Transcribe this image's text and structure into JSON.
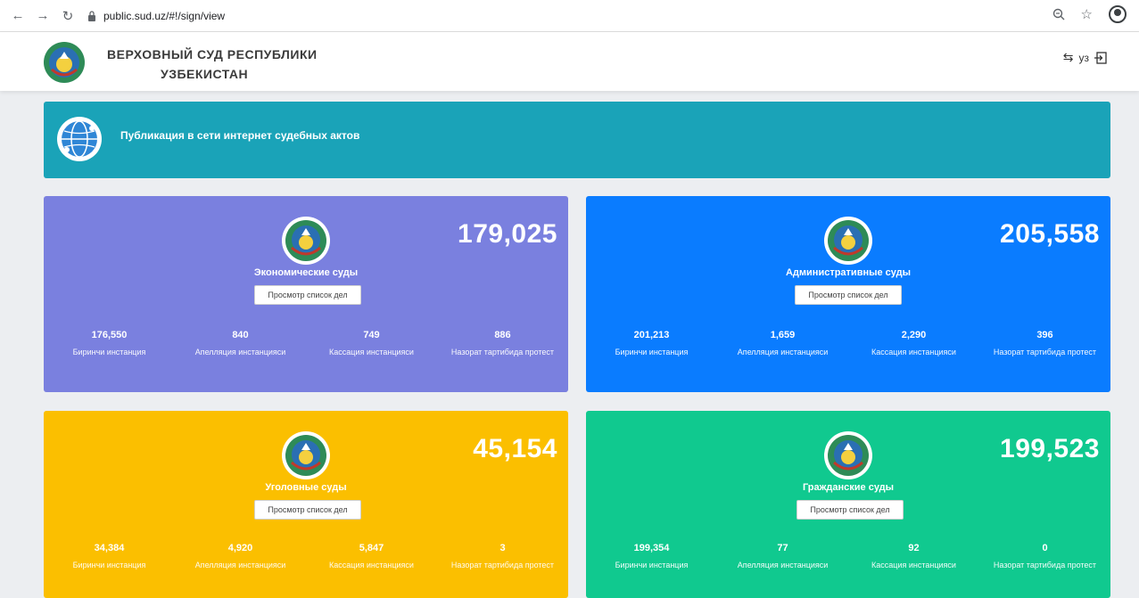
{
  "browser": {
    "url": "public.sud.uz/#!/sign/view"
  },
  "header": {
    "title_line1": "ВЕРХОВНЫЙ СУД РЕСПУБЛИКИ",
    "title_line2": "УЗБЕКИСТАН",
    "lang_label": "уз"
  },
  "banner": {
    "text": "Публикация в сети интернет судебных актов"
  },
  "cards": [
    {
      "name": "Экономические суды",
      "total": "179,025",
      "button": "Просмотр список дел",
      "color": "#7a80df",
      "stats": [
        {
          "value": "176,550",
          "label": "Биринчи инстанция"
        },
        {
          "value": "840",
          "label": "Апелляция инстанцияси"
        },
        {
          "value": "749",
          "label": "Кассация инстанцияси"
        },
        {
          "value": "886",
          "label": "Назорат тартибида протест"
        }
      ]
    },
    {
      "name": "Административные суды",
      "total": "205,558",
      "button": "Просмотр список дел",
      "color": "#0a7cff",
      "stats": [
        {
          "value": "201,213",
          "label": "Биринчи инстанция"
        },
        {
          "value": "1,659",
          "label": "Апелляция инстанцияси"
        },
        {
          "value": "2,290",
          "label": "Кассация инстанцияси"
        },
        {
          "value": "396",
          "label": "Назорат тартибида протест"
        }
      ]
    },
    {
      "name": "Уголовные суды",
      "total": "45,154",
      "button": "Просмотр список дел",
      "color": "#fbbf00",
      "stats": [
        {
          "value": "34,384",
          "label": "Биринчи инстанция"
        },
        {
          "value": "4,920",
          "label": "Апелляция инстанцияси"
        },
        {
          "value": "5,847",
          "label": "Кассация инстанцияси"
        },
        {
          "value": "3",
          "label": "Назорат тартибида протест"
        }
      ]
    },
    {
      "name": "Гражданские суды",
      "total": "199,523",
      "button": "Просмотр список дел",
      "color": "#10c98f",
      "stats": [
        {
          "value": "199,354",
          "label": "Биринчи инстанция"
        },
        {
          "value": "77",
          "label": "Апелляция инстанцияси"
        },
        {
          "value": "92",
          "label": "Кассация инстанцияси"
        },
        {
          "value": "0",
          "label": "Назорат тартибида протест"
        }
      ]
    }
  ]
}
